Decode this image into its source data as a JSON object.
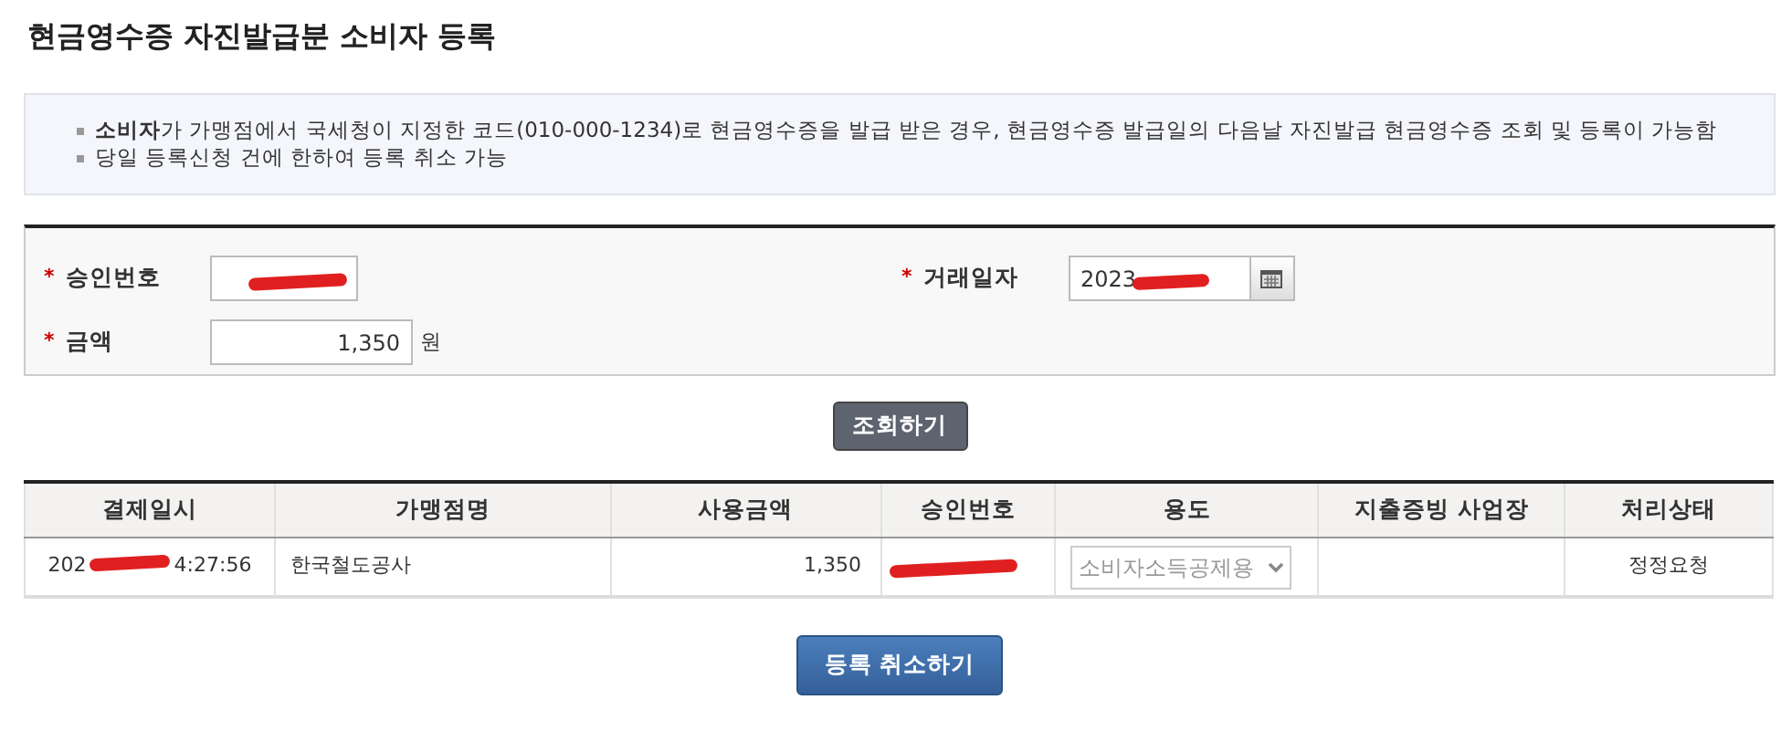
{
  "title": "현금영수증 자진발급분 소비자 등록",
  "notices": [
    "**소비자**가 가맹점에서 국세청이 지정한 코드(010-000-1234)로 현금영수증을 발급 받은 경우, 현금영수증 발급일의 다음날 자진발급 현금영수증 조회 및 등록이 가능함",
    "당일 등록신청 건에 한하여 등록 취소 가능"
  ],
  "form": {
    "fields": [
      {
        "kind": "text",
        "required_mark": "*",
        "label": "승인번호",
        "redacted": true
      },
      {
        "kind": "date",
        "required_mark": "*",
        "label": "거래일자",
        "value": "2023",
        "redacted": true
      },
      {
        "kind": "amount",
        "required_mark": "*",
        "label": "금액",
        "value": "1,350",
        "unit": "원"
      }
    ]
  },
  "search_button": "조회하기",
  "table": {
    "columns": [
      "결제일시",
      "가맹점명",
      "사용금액",
      "승인번호",
      "용도",
      "지출증빙 사업장",
      "처리상태"
    ],
    "rows": [
      {
        "payment_datetime_start": "202",
        "payment_datetime_end": "4:27:56",
        "merchant": "한국철도공사",
        "amount": "1,350",
        "approval_no_redacted": true,
        "purpose": "소비자소득공제용",
        "purpose_disabled": true,
        "status": "정정요청"
      }
    ]
  },
  "cancel_button": "등록 취소하기"
}
